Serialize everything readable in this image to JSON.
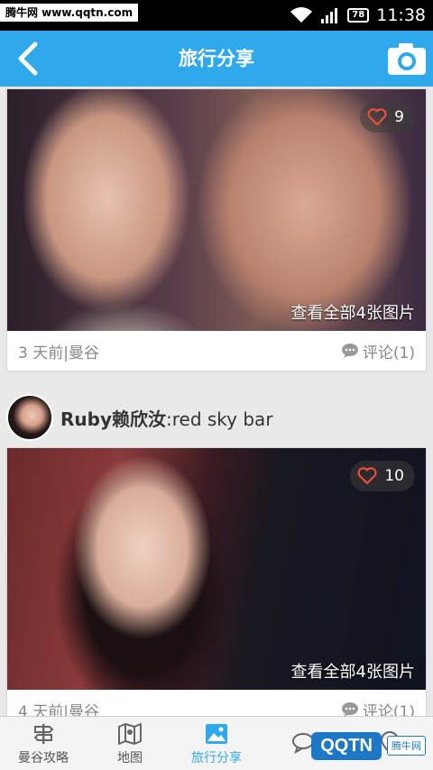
{
  "status_bar": {
    "watermark": "腾牛网 www.qqtn.com",
    "battery": "78",
    "time": "11:38"
  },
  "header": {
    "title": "旅行分享"
  },
  "feed": [
    {
      "likes": "9",
      "view_all": "查看全部4张图片",
      "time_location": "3 天前|曼谷",
      "comments": "评论(1)"
    },
    {
      "user_name": "Ruby赖欣汝",
      "caption": ":red sky bar",
      "likes": "10",
      "view_all": "查看全部4张图片",
      "time_location": "4 天前|曼谷",
      "comments": "评论(1)"
    }
  ],
  "tabs": [
    {
      "label": "曼谷攻略",
      "icon": "signpost-icon"
    },
    {
      "label": "地图",
      "icon": "map-icon"
    },
    {
      "label": "旅行分享",
      "icon": "photo-icon",
      "active": true
    },
    {
      "label": "",
      "icon": "chat-icon"
    },
    {
      "label": "",
      "icon": "location-icon"
    }
  ],
  "watermark_br": {
    "logo": "QQTN",
    "small": "腾牛网"
  },
  "colors": {
    "accent": "#2fa9ec",
    "heart": "#e8503a"
  }
}
